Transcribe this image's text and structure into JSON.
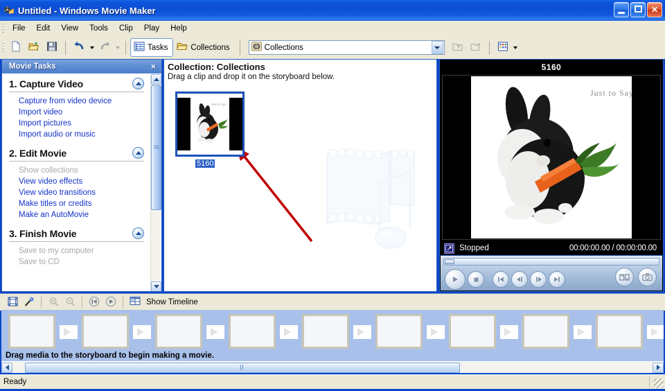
{
  "window": {
    "document_name": "Untitled",
    "app_name": "Windows Movie Maker",
    "title_separator": " - ",
    "icon": "movie-maker-icon",
    "minimize_label": "Minimize",
    "maximize_label": "Maximize",
    "close_label": "Close"
  },
  "menubar": {
    "items": [
      {
        "label": "File"
      },
      {
        "label": "Edit"
      },
      {
        "label": "View"
      },
      {
        "label": "Tools"
      },
      {
        "label": "Clip"
      },
      {
        "label": "Play"
      },
      {
        "label": "Help"
      }
    ]
  },
  "toolbar": {
    "new_project": "new-project-icon",
    "open_project": "open-project-icon",
    "save_project": "save-project-icon",
    "undo": "undo-icon",
    "redo": "redo-icon",
    "tasks_label": "Tasks",
    "collections_label": "Collections",
    "combo_value": "Collections",
    "combo_icon": "collection-icon",
    "up_one_level": "up-one-level-icon",
    "new_collection_folder": "new-collection-folder-icon",
    "views_label": "views-icon"
  },
  "tasks_pane": {
    "title": "Movie Tasks",
    "close_label": "×",
    "sections": [
      {
        "heading": "1. Capture Video",
        "collapse_icon": "chevron-up-icon",
        "links": [
          {
            "label": "Capture from video device",
            "disabled": false
          },
          {
            "label": "Import video",
            "disabled": false
          },
          {
            "label": "Import pictures",
            "disabled": false
          },
          {
            "label": "Import audio or music",
            "disabled": false
          }
        ]
      },
      {
        "heading": "2. Edit Movie",
        "collapse_icon": "chevron-up-icon",
        "links": [
          {
            "label": "Show collections",
            "disabled": true
          },
          {
            "label": "View video effects",
            "disabled": false
          },
          {
            "label": "View video transitions",
            "disabled": false
          },
          {
            "label": "Make titles or credits",
            "disabled": false
          },
          {
            "label": "Make an AutoMovie",
            "disabled": false
          }
        ]
      },
      {
        "heading": "3. Finish Movie",
        "collapse_icon": "chevron-up-icon",
        "links": [
          {
            "label": "Save to my computer",
            "disabled": true
          },
          {
            "label": "Save to CD",
            "disabled": true
          }
        ]
      }
    ]
  },
  "collection_pane": {
    "title": "Collection: Collections",
    "subtitle": "Drag a clip and drop it on the storyboard below.",
    "clips": [
      {
        "name": "5160",
        "selected": true,
        "thumbnail": "rabbit-carrot-thumbnail"
      }
    ],
    "watermark": "filmstrip-music-note-watermark",
    "annotation": "red-arrow-annotation"
  },
  "monitor": {
    "title": "5160",
    "video_frame": "rabbit-carrot-frame",
    "status_text": "Stopped",
    "fullscreen_icon": "fullscreen-icon",
    "current_time": "00:00:00.00",
    "time_separator": "/",
    "total_time": "00:00:00.00",
    "timecode": "00:00:00.00 / 00:00:00.00",
    "controls": [
      {
        "name": "play-button",
        "icon": "play-icon"
      },
      {
        "name": "stop-button",
        "icon": "stop-icon"
      },
      {
        "name": "previous-frame-button",
        "icon": "skip-back-icon"
      },
      {
        "name": "back-frame-button",
        "icon": "step-back-icon"
      },
      {
        "name": "forward-frame-button",
        "icon": "step-forward-icon"
      },
      {
        "name": "next-frame-button",
        "icon": "skip-forward-icon"
      }
    ],
    "right_controls": [
      {
        "name": "split-clip-button",
        "icon": "split-clip-icon"
      },
      {
        "name": "take-picture-button",
        "icon": "camera-icon"
      }
    ]
  },
  "storyboard_toolbar": {
    "buttons": [
      {
        "name": "storyboard-view-button",
        "icon": "storyboard-icon",
        "disabled": false
      },
      {
        "name": "narrate-timeline-button",
        "icon": "microphone-icon",
        "disabled": false
      },
      {
        "name": "zoom-in-button",
        "icon": "zoom-in-icon",
        "disabled": true
      },
      {
        "name": "zoom-out-button",
        "icon": "zoom-out-icon",
        "disabled": true
      },
      {
        "name": "rewind-timeline-button",
        "icon": "rewind-icon",
        "disabled": false
      },
      {
        "name": "play-timeline-button",
        "icon": "play-icon",
        "disabled": false
      }
    ],
    "show_timeline_label": "Show Timeline",
    "show_timeline_icon": "timeline-icon"
  },
  "storyboard": {
    "hint": "Drag media to the storyboard to begin making a movie.",
    "cell_count": 12,
    "transition_count": 11,
    "selected_cell_index": 0
  },
  "statusbar": {
    "text": "Ready"
  },
  "colors": {
    "title_blue": "#0b4ed6",
    "accent_blue": "#1432c8",
    "storyboard_blue": "#a8c0ea",
    "chrome": "#ece9d8",
    "annotation_red": "#c00000",
    "selection_blue": "#2a5fc4"
  }
}
